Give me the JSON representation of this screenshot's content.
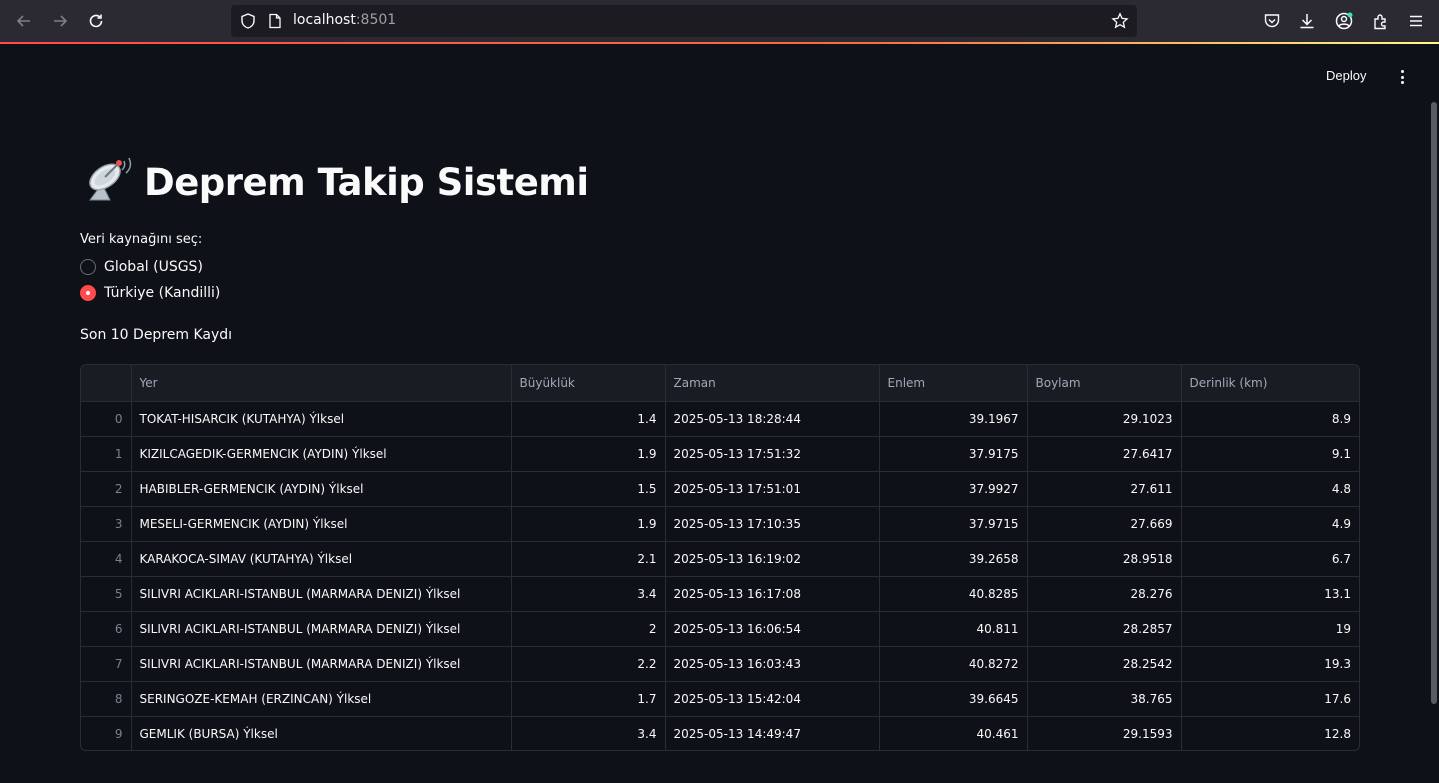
{
  "browser": {
    "url_host": "localhost",
    "url_port": ":8501"
  },
  "header": {
    "deploy_label": "Deploy"
  },
  "page": {
    "title": "Deprem Takip Sistemi",
    "title_icon": "satellite-antenna-icon"
  },
  "source_radio": {
    "label": "Veri kaynağını seç:",
    "options": [
      {
        "label": "Global (USGS)",
        "selected": false
      },
      {
        "label": "Türkiye (Kandilli)",
        "selected": true
      }
    ],
    "accent_color": "#ff4b4b"
  },
  "table_section": {
    "title": "Son 10 Deprem Kaydı",
    "columns": [
      "",
      "Yer",
      "Büyüklük",
      "Zaman",
      "Enlem",
      "Boylam",
      "Derinlik (km)"
    ],
    "rows": [
      [
        "0",
        "TOKAT-HISARCIK (KUTAHYA) Ýlksel",
        "1.4",
        "2025-05-13 18:28:44",
        "39.1967",
        "29.1023",
        "8.9"
      ],
      [
        "1",
        "KIZILCAGEDIK-GERMENCIK (AYDIN) Ýlksel",
        "1.9",
        "2025-05-13 17:51:32",
        "37.9175",
        "27.6417",
        "9.1"
      ],
      [
        "2",
        "HABIBLER-GERMENCIK (AYDIN) Ýlksel",
        "1.5",
        "2025-05-13 17:51:01",
        "37.9927",
        "27.611",
        "4.8"
      ],
      [
        "3",
        "MESELI-GERMENCIK (AYDIN) Ýlksel",
        "1.9",
        "2025-05-13 17:10:35",
        "37.9715",
        "27.669",
        "4.9"
      ],
      [
        "4",
        "KARAKOCA-SIMAV (KUTAHYA) Ýlksel",
        "2.1",
        "2025-05-13 16:19:02",
        "39.2658",
        "28.9518",
        "6.7"
      ],
      [
        "5",
        "SILIVRI ACIKLARI-ISTANBUL (MARMARA DENIZI) Ýlksel",
        "3.4",
        "2025-05-13 16:17:08",
        "40.8285",
        "28.276",
        "13.1"
      ],
      [
        "6",
        "SILIVRI ACIKLARI-ISTANBUL (MARMARA DENIZI) Ýlksel",
        "2",
        "2025-05-13 16:06:54",
        "40.811",
        "28.2857",
        "19"
      ],
      [
        "7",
        "SILIVRI ACIKLARI-ISTANBUL (MARMARA DENIZI) Ýlksel",
        "2.2",
        "2025-05-13 16:03:43",
        "40.8272",
        "28.2542",
        "19.3"
      ],
      [
        "8",
        "SERINGOZE-KEMAH (ERZINCAN) Ýlksel",
        "1.7",
        "2025-05-13 15:42:04",
        "39.6645",
        "38.765",
        "17.6"
      ],
      [
        "9",
        "GEMLIK (BURSA) Ýlksel",
        "3.4",
        "2025-05-13 14:49:47",
        "40.461",
        "29.1593",
        "12.8"
      ]
    ]
  }
}
